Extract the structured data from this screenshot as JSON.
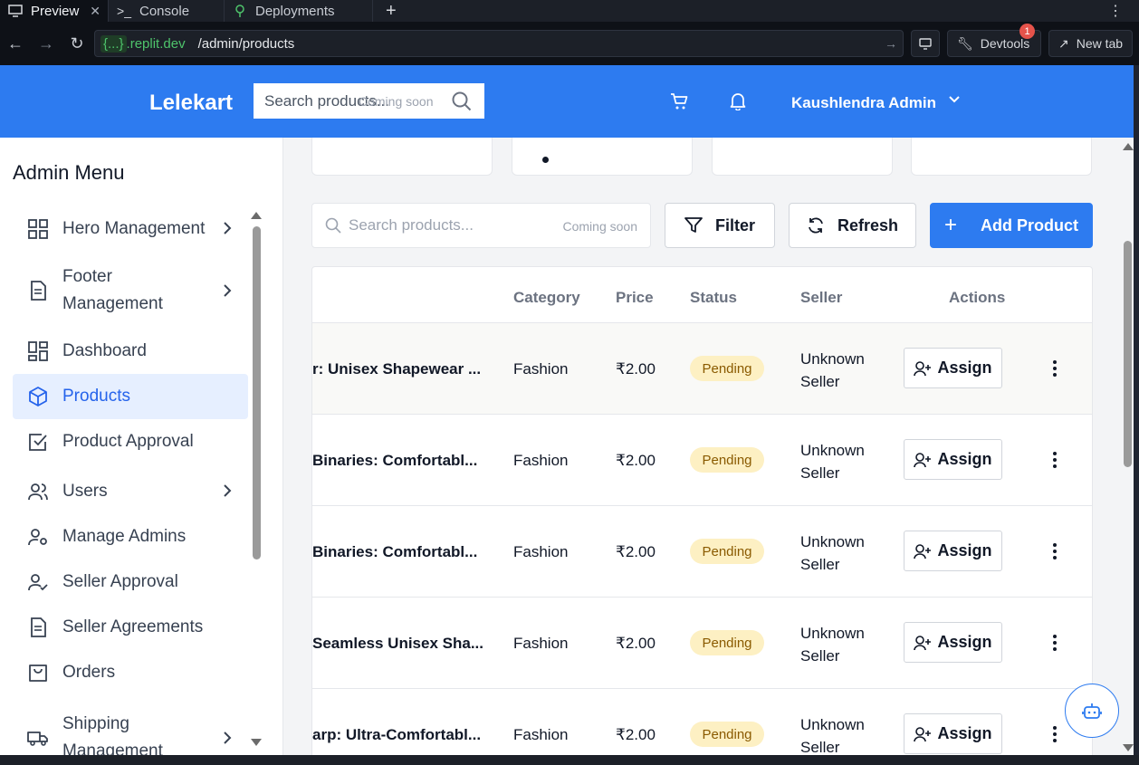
{
  "browser": {
    "tabs": [
      {
        "label": "Preview",
        "icon": "monitor-icon"
      },
      {
        "label": "Console",
        "icon": "terminal-icon"
      },
      {
        "label": "Deployments",
        "icon": "deploy-icon"
      }
    ],
    "url_host": "{...}",
    "url_host_suffix": ".replit.dev",
    "url_path": "/admin/products",
    "devtools_label": "Devtools",
    "devtools_badge": "1",
    "new_tab_label": "New tab"
  },
  "header": {
    "brand": "Lelekart",
    "search_placeholder": "Search products...",
    "search_hint": "Coming soon",
    "user_name": "Kaushlendra Admin"
  },
  "sidebar": {
    "title": "Admin Menu",
    "items": [
      {
        "label": "Hero Management",
        "icon": "grid-icon",
        "has_chevron": true
      },
      {
        "label": "Footer Management",
        "icon": "document-icon",
        "has_chevron": true
      },
      {
        "label": "Dashboard",
        "icon": "dashboard-icon",
        "has_chevron": false
      },
      {
        "label": "Products",
        "icon": "package-icon",
        "has_chevron": false,
        "active": true
      },
      {
        "label": "Product Approval",
        "icon": "check-square-icon",
        "has_chevron": false
      },
      {
        "label": "Users",
        "icon": "users-icon",
        "has_chevron": true
      },
      {
        "label": "Manage Admins",
        "icon": "user-cog-icon",
        "has_chevron": false
      },
      {
        "label": "Seller Approval",
        "icon": "user-check-icon",
        "has_chevron": false
      },
      {
        "label": "Seller Agreements",
        "icon": "document-icon",
        "has_chevron": false
      },
      {
        "label": "Orders",
        "icon": "shopping-bag-icon",
        "has_chevron": false
      },
      {
        "label": "Shipping Management",
        "icon": "truck-icon",
        "has_chevron": true
      }
    ]
  },
  "toolbar": {
    "search_placeholder": "Search products...",
    "search_hint": "Coming soon",
    "filter_label": "Filter",
    "refresh_label": "Refresh",
    "add_label": "Add Product"
  },
  "table": {
    "columns": [
      "Category",
      "Price",
      "Status",
      "Seller",
      "Actions"
    ],
    "rows": [
      {
        "name": "r: Unisex Shapewear ...",
        "category": "Fashion",
        "price": "₹2.00",
        "status": "Pending",
        "seller_line1": "Unknown",
        "seller_line2": "Seller",
        "action": "Assign"
      },
      {
        "name": "Binaries: Comfortabl...",
        "category": "Fashion",
        "price": "₹2.00",
        "status": "Pending",
        "seller_line1": "Unknown",
        "seller_line2": "Seller",
        "action": "Assign"
      },
      {
        "name": "Binaries: Comfortabl...",
        "category": "Fashion",
        "price": "₹2.00",
        "status": "Pending",
        "seller_line1": "Unknown",
        "seller_line2": "Seller",
        "action": "Assign"
      },
      {
        "name": "Seamless Unisex Sha...",
        "category": "Fashion",
        "price": "₹2.00",
        "status": "Pending",
        "seller_line1": "Unknown",
        "seller_line2": "Seller",
        "action": "Assign"
      },
      {
        "name": "arp: Ultra-Comfortabl...",
        "category": "Fashion",
        "price": "₹2.00",
        "status": "Pending",
        "seller_line1": "Unknown",
        "seller_line2": "Seller",
        "action": "Assign"
      }
    ]
  },
  "colors": {
    "brand_blue": "#2d7bf0",
    "pending_bg": "#fdf0c3",
    "active_bg": "#e6efff"
  }
}
